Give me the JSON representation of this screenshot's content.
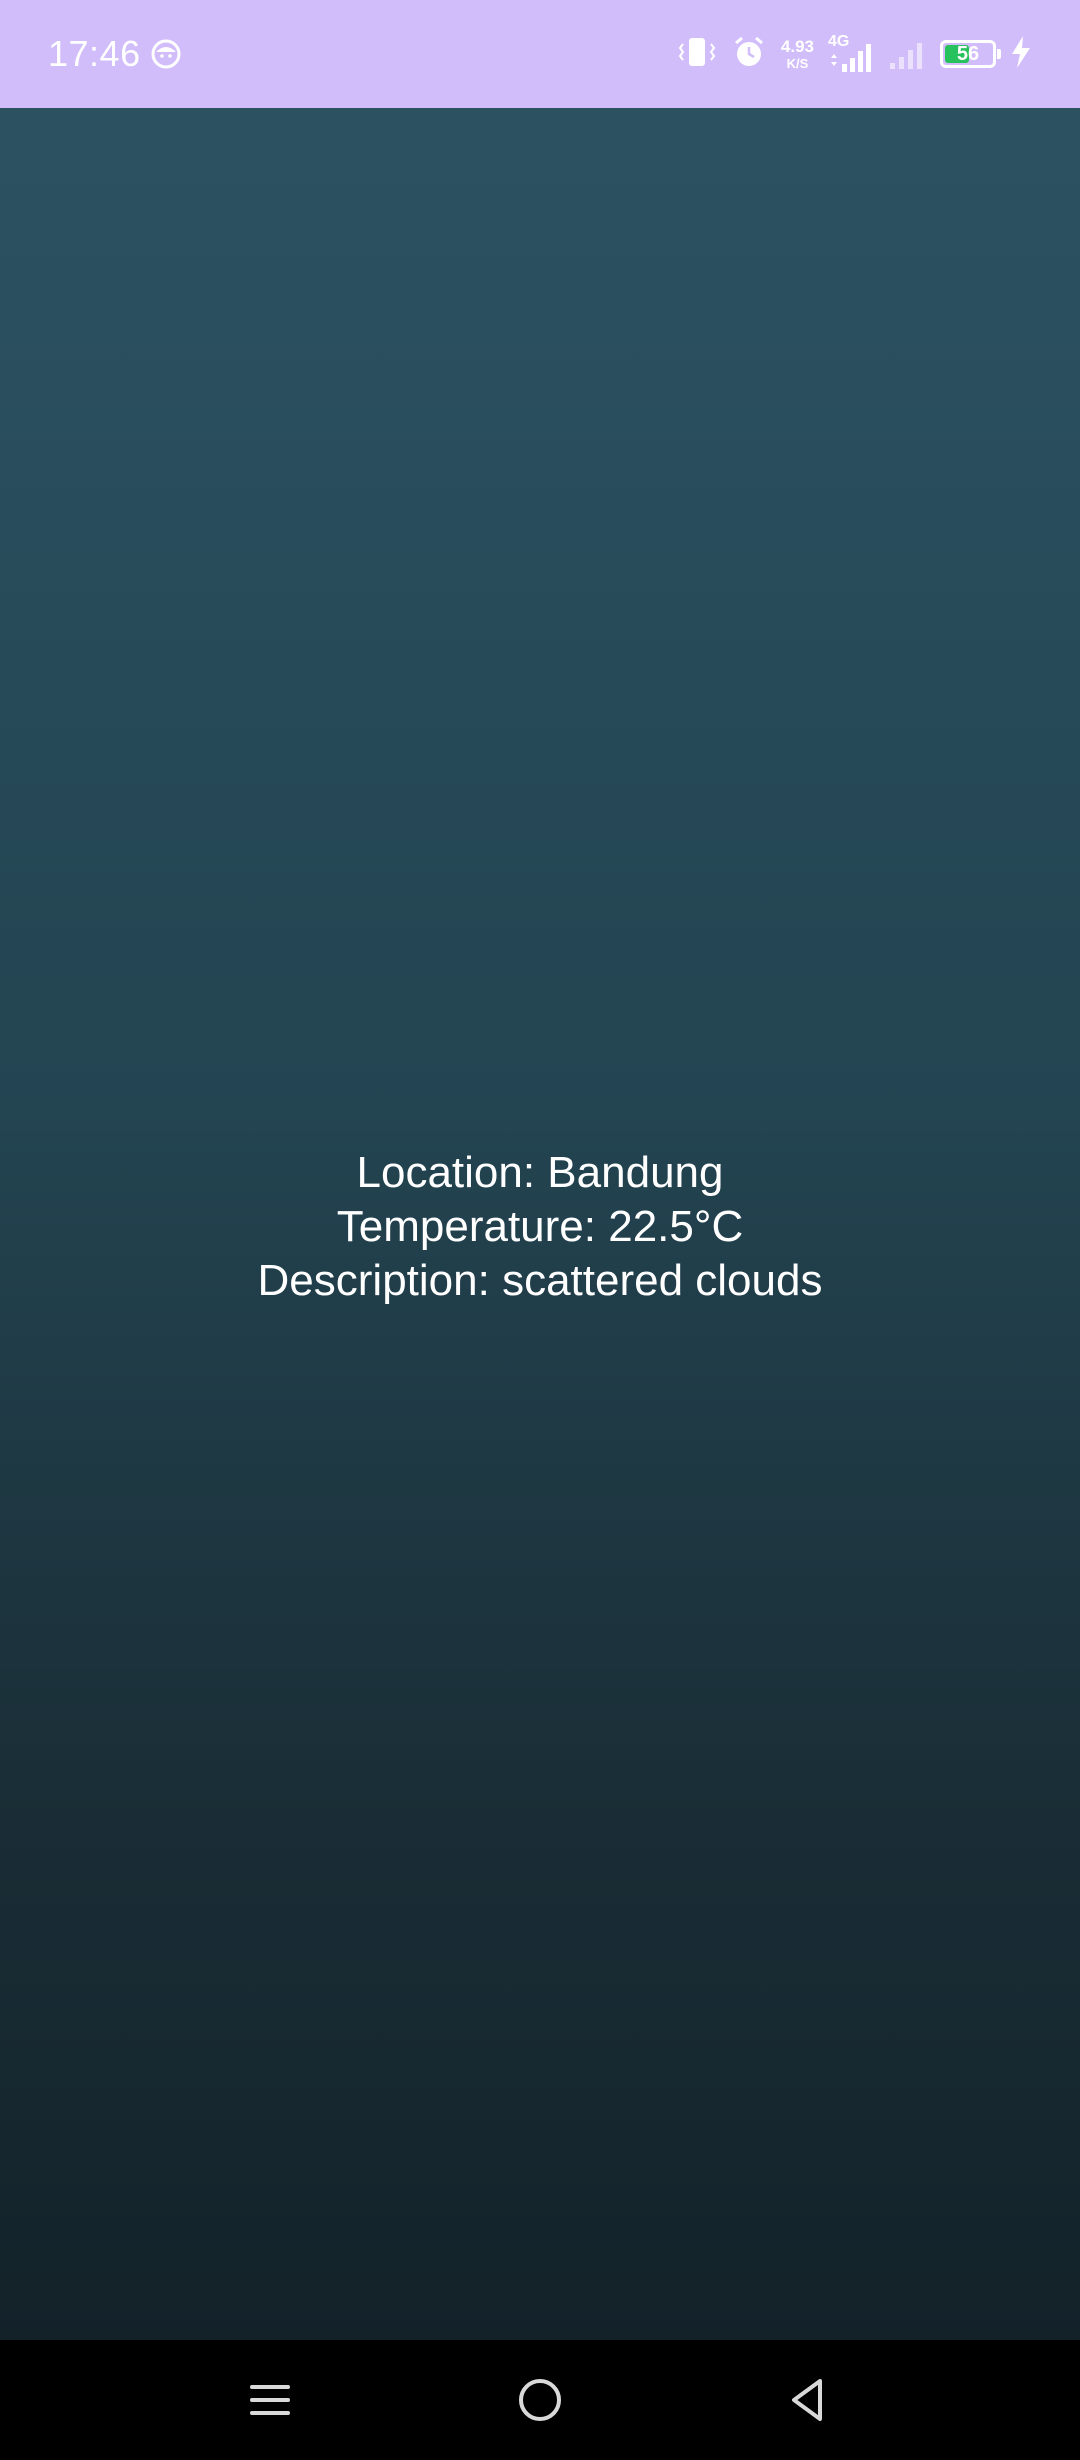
{
  "status_bar": {
    "time": "17:46",
    "network_speed_value": "4.93",
    "network_speed_unit": "K/S",
    "network_type": "4G",
    "battery_level": "56",
    "battery_fraction": 0.56,
    "icons": [
      "face-app-icon",
      "vibrate-icon",
      "alarm-icon",
      "signal-4g-icon",
      "signal-weak-icon",
      "battery-icon",
      "charging-icon"
    ],
    "background_color": "#d2bdfb"
  },
  "weather": {
    "location": "Location: Bandung",
    "temperature": "Temperature: 22.5°C",
    "description": "Description: scattered clouds"
  },
  "nav_bar": {
    "buttons": [
      "menu-icon",
      "home-icon",
      "back-icon"
    ]
  }
}
